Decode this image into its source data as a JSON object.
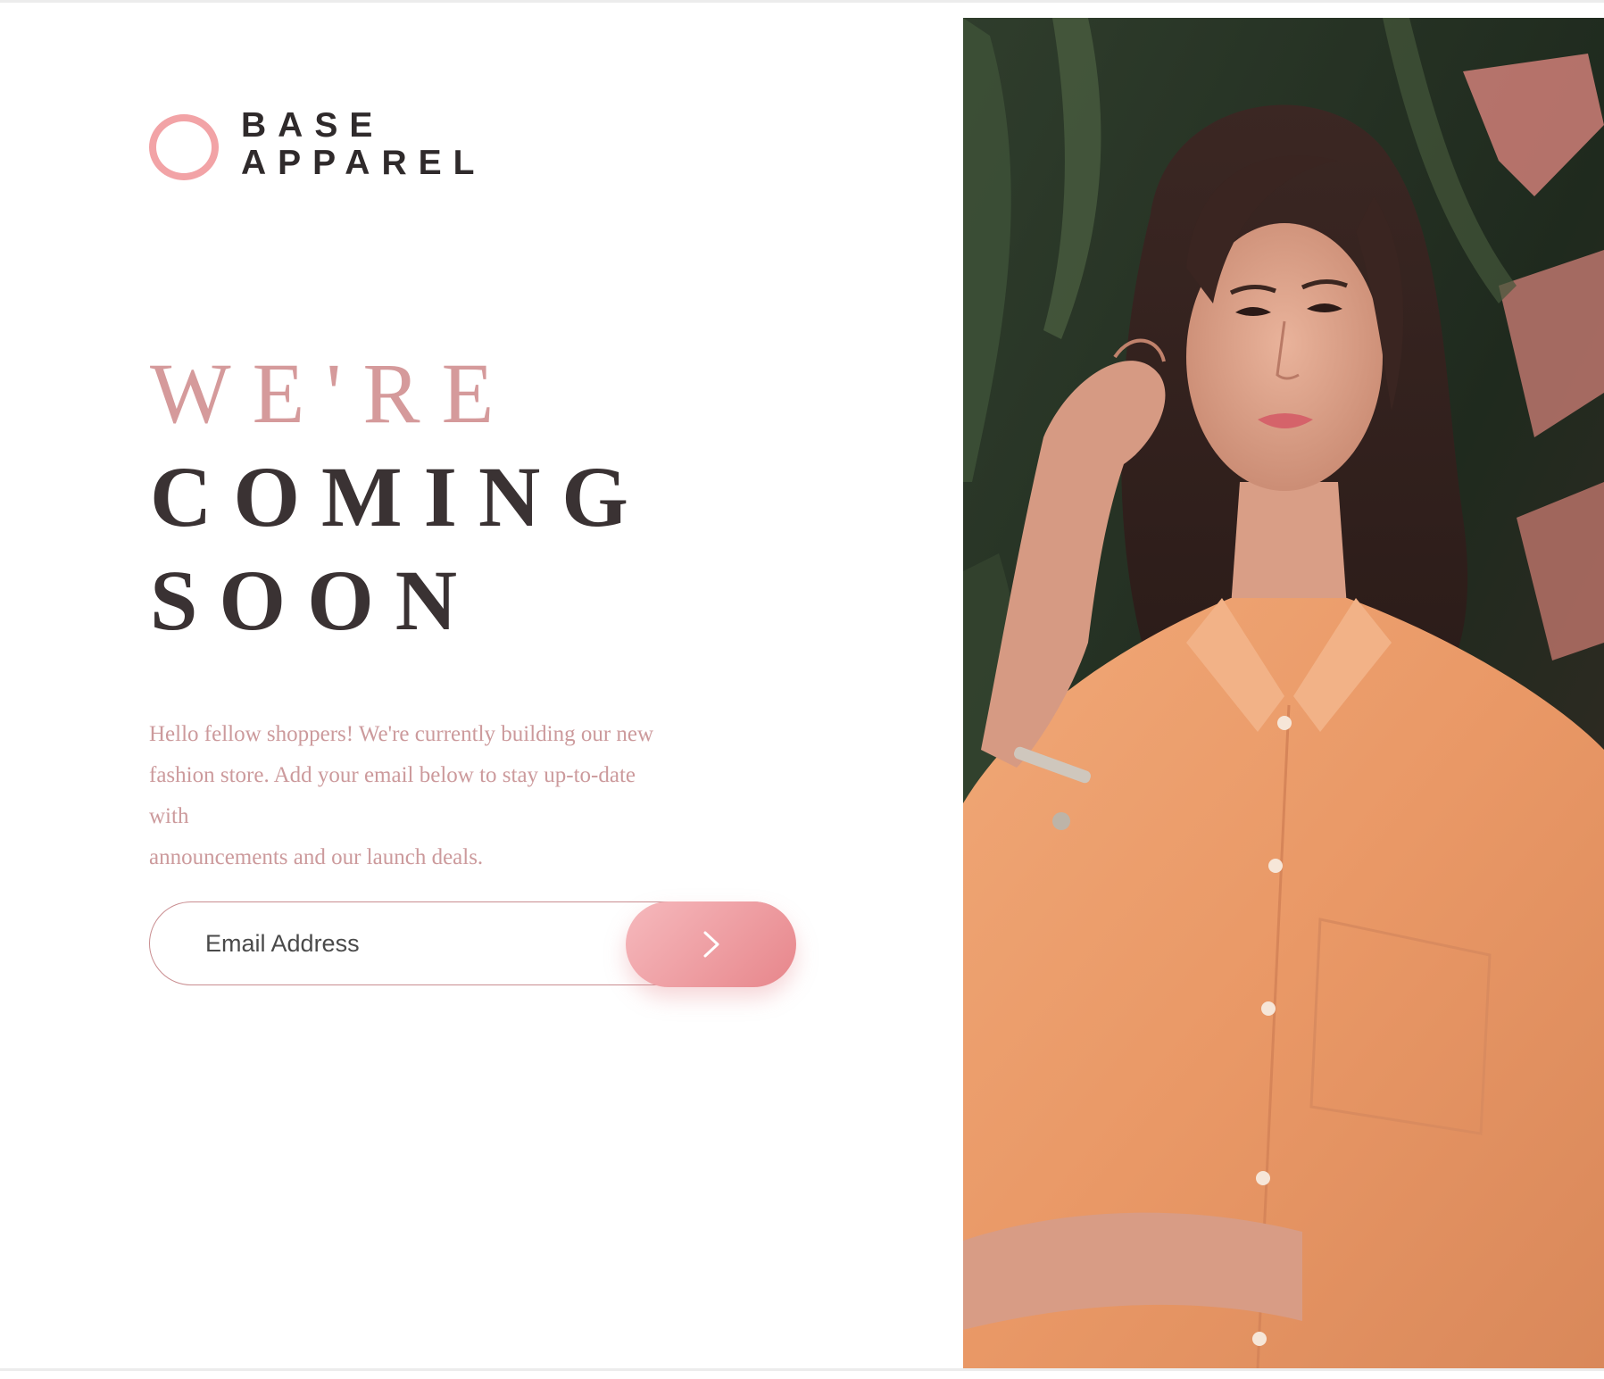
{
  "logo": {
    "line1": "BASE",
    "line2": "APPAREL",
    "ring_color": "#f2a3a6"
  },
  "heading": {
    "line1": "WE'RE",
    "line2": "COMING",
    "line3": "SOON"
  },
  "intro": {
    "line1": "Hello fellow shoppers! We're currently building our new",
    "line2": "fashion store. Add your email below to stay up-to-date",
    "line3": "with",
    "line4": "announcements and our launch deals."
  },
  "form": {
    "email_placeholder": "Email Address",
    "submit_icon": "chevron-right-icon"
  },
  "colors": {
    "accent": "#f2a3a6",
    "heading_light": "#d59a9b",
    "heading_dark": "#3a3233",
    "body_text": "#cc9a9c"
  },
  "hero": {
    "icon": "woman-in-orange-shirt-photo"
  }
}
